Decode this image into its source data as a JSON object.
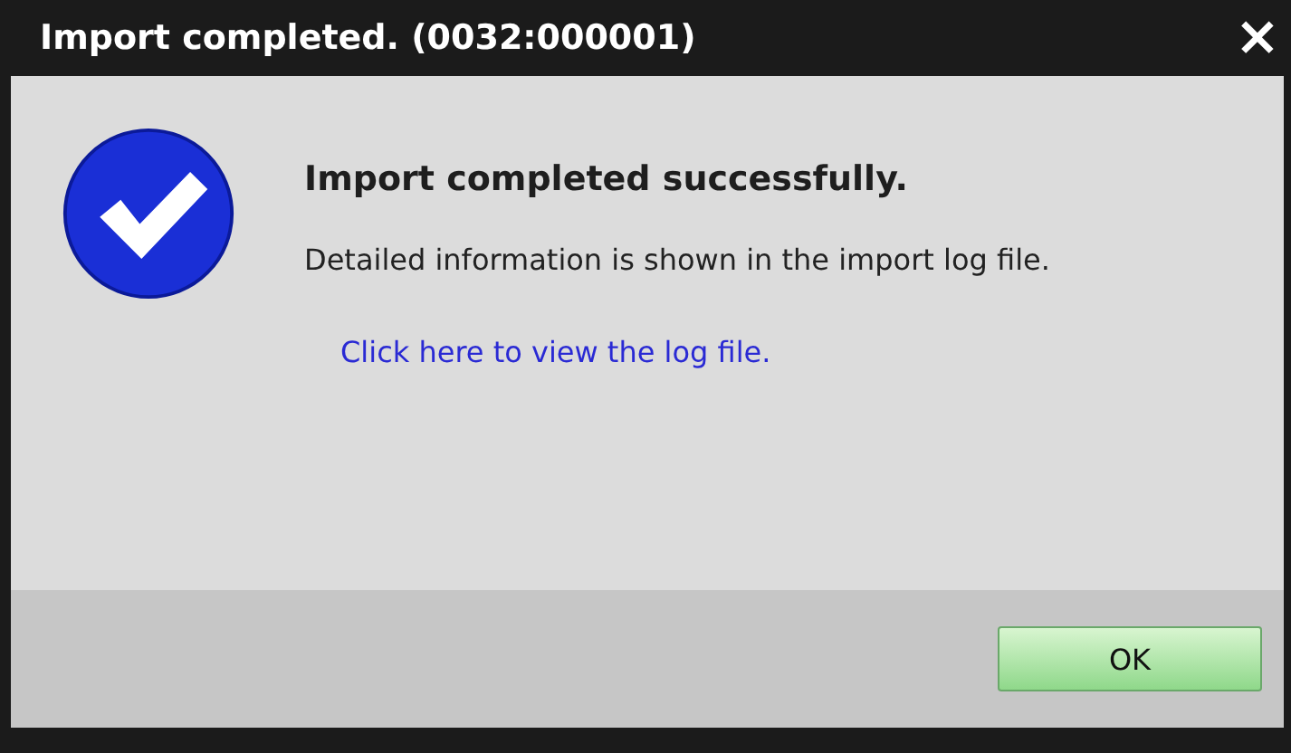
{
  "window": {
    "title": "Import completed. (0032:000001)",
    "close": "×"
  },
  "message": {
    "heading": "Import completed successfully.",
    "detail": "Detailed information is shown in the import log file.",
    "link": "Click here to view the log file."
  },
  "buttons": [
    "OK"
  ]
}
